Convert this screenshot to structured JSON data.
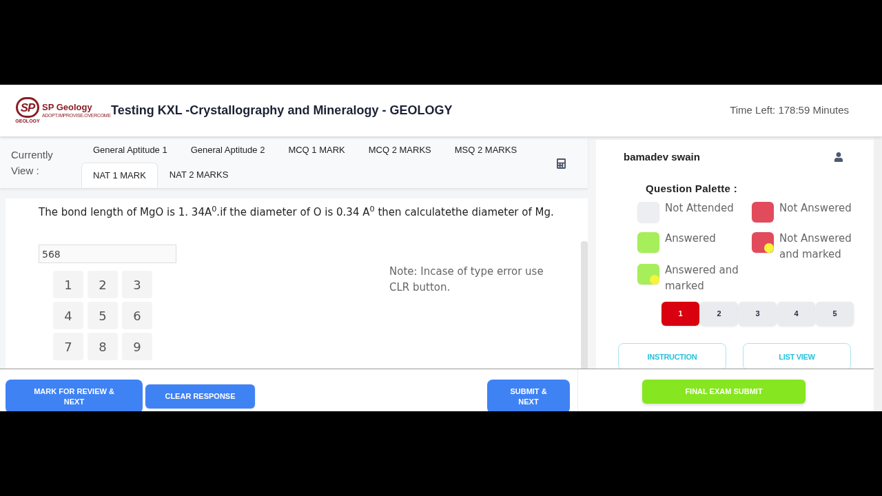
{
  "header": {
    "logo": {
      "mark": "SP",
      "name": "SP Geology",
      "tagline": "ADOPT.IMPROVISE.OVERCOME",
      "sub": "GEOLOGY"
    },
    "title": "Testing KXL -Crystallography and Mineralogy - GEOLOGY",
    "time_left": "Time Left: 178:59 Minutes"
  },
  "sections": {
    "label": "Currently View :",
    "tabs": [
      {
        "label": "General Aptitude 1",
        "selected": false
      },
      {
        "label": "General Aptitude 2",
        "selected": false
      },
      {
        "label": "MCQ 1 MARK",
        "selected": false
      },
      {
        "label": "MCQ 2 MARKS",
        "selected": false
      },
      {
        "label": "MSQ 2 MARKS",
        "selected": false
      },
      {
        "label": "NAT 1 MARK",
        "selected": true
      },
      {
        "label": "NAT 2 MARKS",
        "selected": false
      }
    ]
  },
  "question": {
    "text": "The bond length of MgO is 1. 34A$^{0}$.if the diameter of O is 0.34 A$^{0}$ then calculatethe diameter of Mg.",
    "answer": "568",
    "keypad": [
      "1",
      "2",
      "3",
      "4",
      "5",
      "6",
      "7",
      "8",
      "9"
    ],
    "note": "Note: Incase of type error use CLR button."
  },
  "user": {
    "name": "bamadev swain"
  },
  "palette": {
    "title": "Question Palette :",
    "legend": [
      {
        "label": "Not Attended",
        "color": "#eceef1",
        "marked": false
      },
      {
        "label": "Not Answered",
        "color": "#e24b5b",
        "marked": false
      },
      {
        "label": "Answered",
        "color": "#a6ee5a",
        "marked": false
      },
      {
        "label": "Not Answered and marked",
        "color": "#e24b5b",
        "marked": true
      },
      {
        "label": "Answered and marked",
        "color": "#a6ee5a",
        "marked": true
      }
    ],
    "questions": [
      {
        "label": "1",
        "color": "#d9000f"
      },
      {
        "label": "2",
        "color": "#e9ebef"
      },
      {
        "label": "3",
        "color": "#e9ebef"
      },
      {
        "label": "4",
        "color": "#e9ebef"
      },
      {
        "label": "5",
        "color": "#e9ebef"
      }
    ]
  },
  "links": [
    "INSTRUCTION",
    "LIST VIEW"
  ],
  "actions": {
    "left": [
      "MARK FOR REVIEW & NEXT",
      "CLEAR RESPONSE"
    ],
    "submit": "SUBMIT & NEXT",
    "final_submit": "FINAL EXAM SUBMIT"
  }
}
